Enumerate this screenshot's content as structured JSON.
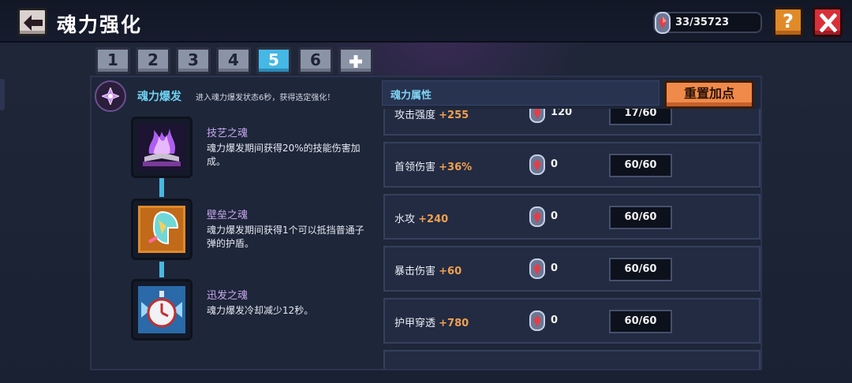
{
  "header": {
    "title": "魂力强化",
    "currency": {
      "icon": "soul-gem-icon",
      "value": "33/35723"
    },
    "help_label": "?"
  },
  "tabs": [
    {
      "label": "1",
      "active": false
    },
    {
      "label": "2",
      "active": false
    },
    {
      "label": "3",
      "active": false
    },
    {
      "label": "4",
      "active": false
    },
    {
      "label": "5",
      "active": true
    },
    {
      "label": "6",
      "active": false
    }
  ],
  "burst": {
    "title": "魂力爆发",
    "description": "进入魂力爆发状态6秒，获得选定强化！"
  },
  "souls": [
    {
      "name": "技艺之魂",
      "description": "魂力爆发期间获得20%的技能伤害加成。",
      "icon": "purple-flame-book-icon"
    },
    {
      "name": "壁垒之魂",
      "description": "魂力爆发期间获得1个可以抵挡普通子弹的护盾。",
      "icon": "shield-icon"
    },
    {
      "name": "迅发之魂",
      "description": "魂力爆发冷却减少12秒。",
      "icon": "stopwatch-icon"
    }
  ],
  "attributes": {
    "header": "魂力属性",
    "reset_label": "重置加点",
    "rows": [
      {
        "name": "攻击强度",
        "bonus": "+255",
        "cost": "120",
        "level": "17/60"
      },
      {
        "name": "首领伤害",
        "bonus": "+36%",
        "cost": "0",
        "level": "60/60"
      },
      {
        "name": "水攻",
        "bonus": "+240",
        "cost": "0",
        "level": "60/60"
      },
      {
        "name": "暴击伤害",
        "bonus": "+60",
        "cost": "0",
        "level": "60/60"
      },
      {
        "name": "护甲穿透",
        "bonus": "+780",
        "cost": "0",
        "level": "60/60"
      }
    ]
  },
  "colors": {
    "accent": "#45b8e6",
    "bonus": "#f0a050",
    "reset": "#f08a4a",
    "close": "#d8303a",
    "help": "#e08a2a"
  }
}
